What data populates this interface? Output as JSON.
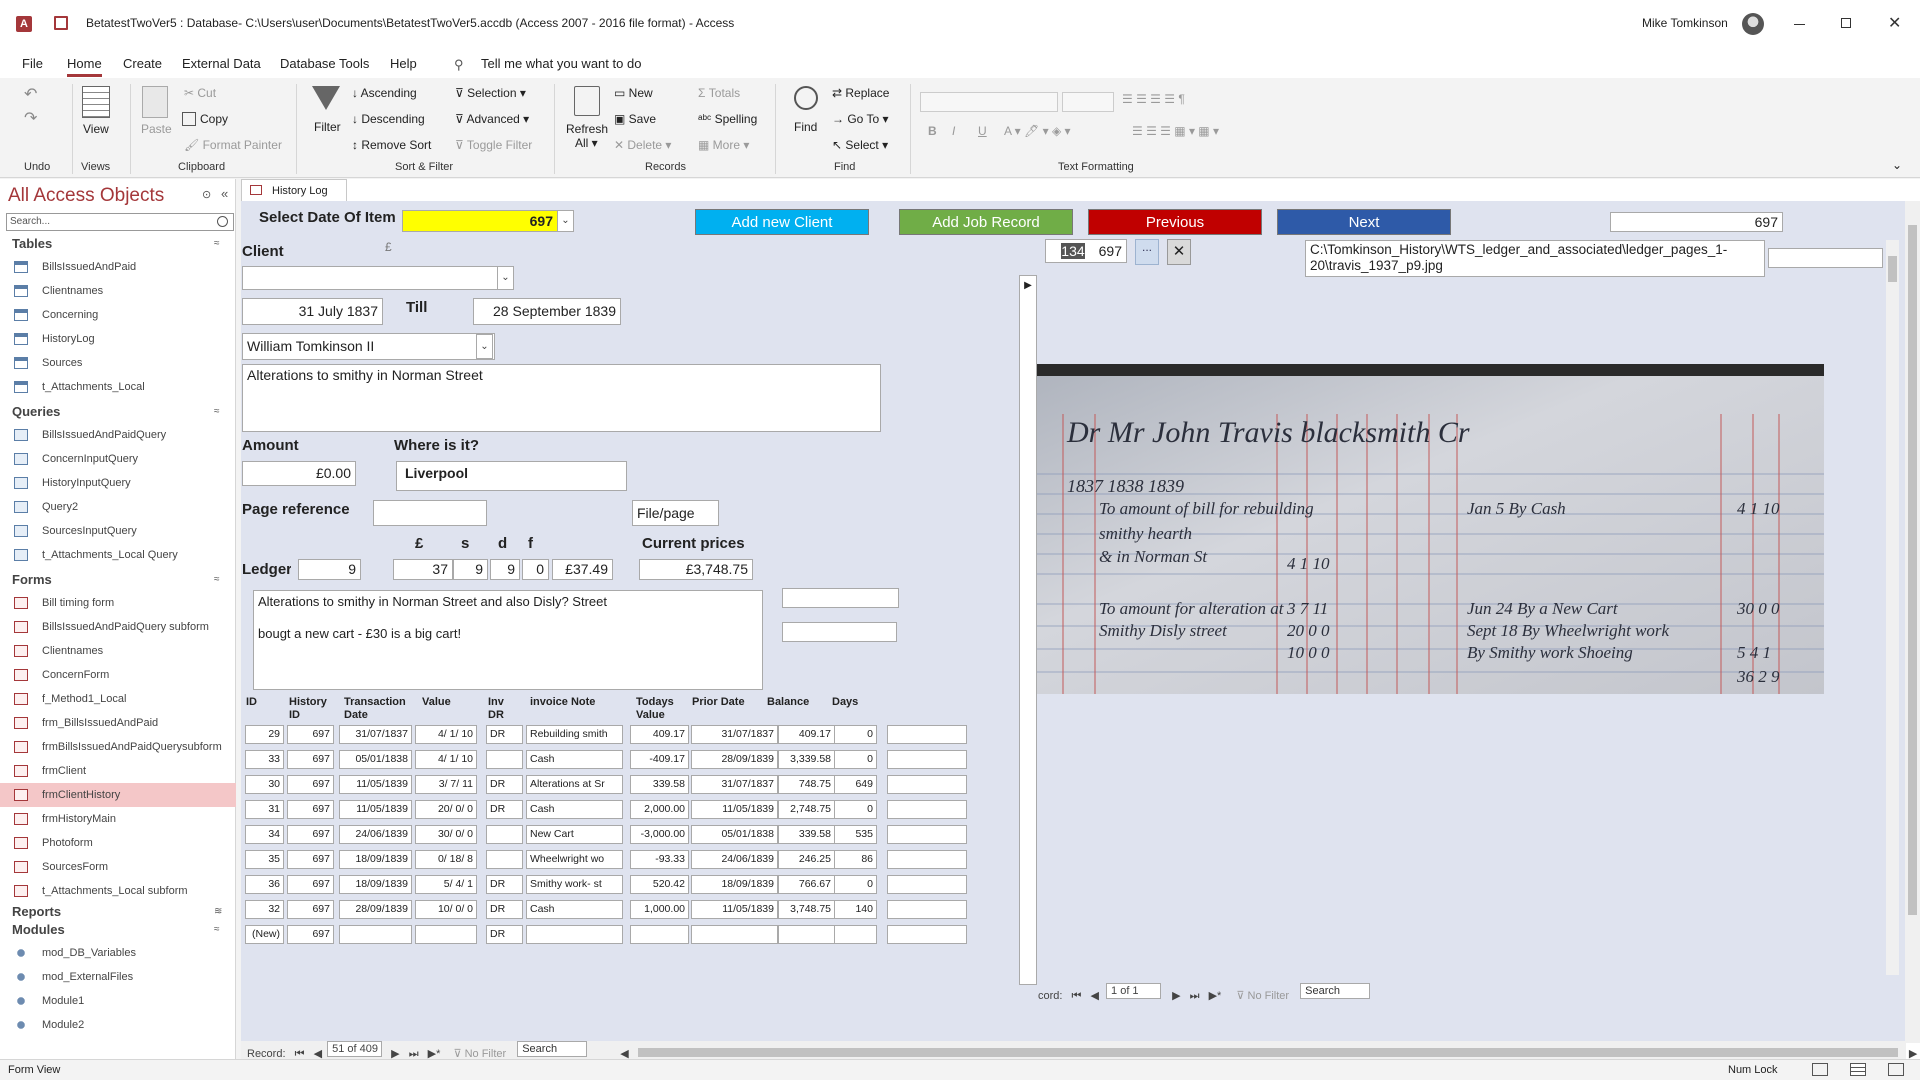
{
  "titlebar": {
    "title": "BetatestTwoVer5 : Database- C:\\Users\\user\\Documents\\BetatestTwoVer5.accdb (Access 2007 - 2016 file format)  - Access",
    "user": "Mike Tomkinson"
  },
  "menu": [
    "File",
    "Home",
    "Create",
    "External Data",
    "Database Tools",
    "Help"
  ],
  "tellme": "Tell me what you want to do",
  "ribbon": {
    "undo_group": "Undo",
    "view": "View",
    "views_group": "Views",
    "paste": "Paste",
    "cut": "Cut",
    "copy": "Copy",
    "format_painter": "Format Painter",
    "clipboard_group": "Clipboard",
    "filter": "Filter",
    "ascending": "Ascending",
    "descending": "Descending",
    "remove_sort": "Remove Sort",
    "selection": "Selection",
    "advanced": "Advanced",
    "toggle_filter": "Toggle Filter",
    "sortfilter_group": "Sort & Filter",
    "refresh": "Refresh",
    "refresh_all": "All",
    "new": "New",
    "save": "Save",
    "delete": "Delete",
    "totals": "Totals",
    "spelling": "Spelling",
    "more": "More",
    "records_group": "Records",
    "find": "Find",
    "replace": "Replace",
    "goto": "Go To",
    "select": "Select",
    "find_group": "Find",
    "textformatting_group": "Text Formatting"
  },
  "nav": {
    "title": "All Access Objects",
    "search_placeholder": "Search...",
    "sections": {
      "tables": "Tables",
      "queries": "Queries",
      "forms": "Forms",
      "reports": "Reports",
      "modules": "Modules"
    },
    "tables": [
      "BillsIssuedAndPaid",
      "Clientnames",
      "Concerning",
      "HistoryLog",
      "Sources",
      "t_Attachments_Local"
    ],
    "queries": [
      "BillsIssuedAndPaidQuery",
      "ConcernInputQuery",
      "HistoryInputQuery",
      "Query2",
      "SourcesInputQuery",
      "t_Attachments_Local Query"
    ],
    "forms": [
      "Bill timing form",
      "BillsIssuedAndPaidQuery subform",
      "Clientnames",
      "ConcernForm",
      "f_Method1_Local",
      "frm_BillsIssuedAndPaid",
      "frmBillsIssuedAndPaidQuerysubform",
      "frmClient",
      "frmClientHistory",
      "frmHistoryMain",
      "Photoform",
      "SourcesForm",
      "t_Attachments_Local subform"
    ],
    "selected_form": "frmClientHistory",
    "modules": [
      "mod_DB_Variables",
      "mod_ExternalFiles",
      "Module1",
      "Module2"
    ]
  },
  "tab": "History Log",
  "form": {
    "select_date_label": "Select Date Of Item",
    "select_date_value": "697",
    "add_client": "Add new Client",
    "add_job": "Add Job Record",
    "previous": "Previous",
    "next": "Next",
    "top_id": "697",
    "client_label": "Client",
    "pound_mark": "£",
    "date_from": "31 July 1837",
    "till_label": "Till",
    "date_till": "28 September 1839",
    "person": "William Tomkinson II",
    "description": "Alterations to smithy in Norman Street",
    "amount_label": "Amount",
    "amount": "£0.00",
    "where_label": "Where is it?",
    "where": "Liverpool",
    "page_ref_label": "Page reference",
    "file_page": "File/page",
    "col_pound": "£",
    "col_s": "s",
    "col_d": "d",
    "col_f": "f",
    "current_prices_label": "Current prices",
    "ledger_label": "Ledger",
    "ledger_no": "9",
    "pounds": "37",
    "shillings": "9",
    "pence": "9",
    "farthings": "0",
    "decimal": "£37.49",
    "current_price": "£3,748.75",
    "notes_line1": "Alterations to smithy in Norman Street and also Disly? Street",
    "notes_line2": "bougt a new cart -  £30 is a big cart!"
  },
  "table": {
    "headers": [
      "ID",
      "History ID",
      "Transaction Date",
      "Value",
      "Inv DR",
      "invoice Note",
      "Todays Value",
      "Prior Date",
      "Balance",
      "Days"
    ],
    "rows": [
      [
        "29",
        "697",
        "31/07/1837",
        "4/  1/ 10",
        "DR",
        "Rebuilding smith",
        "409.17",
        "31/07/1837",
        "409.17",
        "0"
      ],
      [
        "33",
        "697",
        "05/01/1838",
        "4/  1/ 10",
        "",
        "Cash",
        "-409.17",
        "28/09/1839",
        "3,339.58",
        "0"
      ],
      [
        "30",
        "697",
        "11/05/1839",
        "3/  7/ 11",
        "DR",
        "Alterations at Sr",
        "339.58",
        "31/07/1837",
        "748.75",
        "649"
      ],
      [
        "31",
        "697",
        "11/05/1839",
        "20/  0/ 0",
        "DR",
        "Cash",
        "2,000.00",
        "11/05/1839",
        "2,748.75",
        "0"
      ],
      [
        "34",
        "697",
        "24/06/1839",
        "30/  0/ 0",
        "",
        "New Cart",
        "-3,000.00",
        "05/01/1838",
        "339.58",
        "535"
      ],
      [
        "35",
        "697",
        "18/09/1839",
        "0/  18/ 8",
        "",
        "Wheelwright wo",
        "-93.33",
        "24/06/1839",
        "246.25",
        "86"
      ],
      [
        "36",
        "697",
        "18/09/1839",
        "5/  4/ 1",
        "DR",
        "Smithy work- st",
        "520.42",
        "18/09/1839",
        "766.67",
        "0"
      ],
      [
        "32",
        "697",
        "28/09/1839",
        "10/  0/ 0",
        "DR",
        "Cash",
        "1,000.00",
        "11/05/1839",
        "3,748.75",
        "140"
      ],
      [
        "(New)",
        "697",
        "",
        "",
        "DR",
        "",
        "",
        "",
        "",
        ""
      ]
    ]
  },
  "attachment": {
    "num1": "134",
    "num2": "697",
    "browse": "...",
    "path": "C:\\Tomkinson_History\\WTS_ledger_and_associated\\ledger_pages_1-20\\travis_1937_p9.jpg"
  },
  "ledger_image": {
    "header": "Dr  Mr John Travis blacksmith Cr",
    "years": "1837  1838  1839"
  },
  "subnav": {
    "record": "cord:",
    "pos": "1 of 1",
    "nofilter": "No Filter",
    "search": "Search"
  },
  "mainnav": {
    "record": "Record:",
    "pos": "51 of 409",
    "nofilter": "No Filter",
    "search": "Search"
  },
  "status": {
    "left": "Form View",
    "right": "Num Lock"
  },
  "colors": {
    "accent": "#a4373a",
    "yellow": "#ffff00",
    "blue_btn": "#00b0f0",
    "green_btn": "#70ad47",
    "red_btn": "#c00000",
    "navy_btn": "#2e5aa8"
  }
}
